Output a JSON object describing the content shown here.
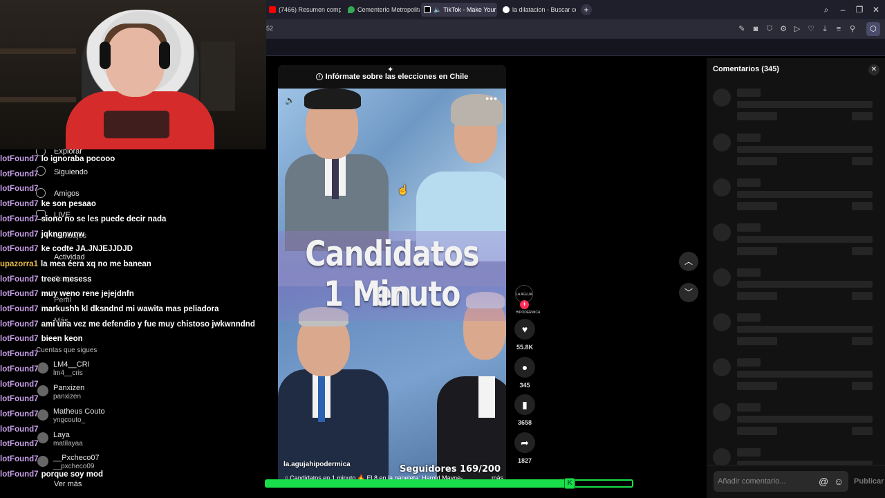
{
  "browser": {
    "tabs": [
      {
        "label": "(7466) Resumen complet",
        "color": "#ff0000",
        "active": false
      },
      {
        "label": "Cementerio Metropolitan",
        "color": "#34a853",
        "active": false
      },
      {
        "label": "TikTok - Make Your D",
        "color": "#ffffff",
        "active": true
      },
      {
        "label": "la dilatacion - Buscar con",
        "color": "#4285f4",
        "active": false
      }
    ],
    "address_fragment": "52"
  },
  "chat": {
    "messages": [
      {
        "user": "lotFound7",
        "text": "lo ignoraba pocooo"
      },
      {
        "user": "lotFound7",
        "text": ""
      },
      {
        "user": "lotFound7",
        "text": ""
      },
      {
        "user": "lotFound7",
        "text": "ke son pesaao"
      },
      {
        "user": "lotFound7",
        "text": "siono no se les puede decir nada"
      },
      {
        "user": "lotFound7",
        "text": "jqkngnwnw"
      },
      {
        "user": "lotFound7",
        "text": "ke codte JA.JNJEJJDJD"
      },
      {
        "user": "upazorra1",
        "text": "la mea éera xq no me banean",
        "gold": true
      },
      {
        "user": "lotFound7",
        "text": "treee mesess"
      },
      {
        "user": "lotFound7",
        "text": "muy weno rene jejejdnfn"
      },
      {
        "user": "lotFound7",
        "text": "markushh kl dksndnd mi wawita mas peliadora"
      },
      {
        "user": "lotFound7",
        "text": "ami una vez me defendio y fue muy chistoso jwkwnndnd"
      },
      {
        "user": "lotFound7",
        "text": "bieen keon"
      },
      {
        "user": "lotFound7",
        "text": ""
      },
      {
        "user": "lotFound7",
        "text": ""
      },
      {
        "user": "lotFound7",
        "text": ""
      },
      {
        "user": "lotFound7",
        "text": ""
      },
      {
        "user": "lotFound7",
        "text": ""
      },
      {
        "user": "lotFound7",
        "text": ""
      },
      {
        "user": "lotFound7",
        "text": ""
      },
      {
        "user": "lotFound7",
        "text": ""
      },
      {
        "user": "lotFound7",
        "text": "porque soy mod"
      }
    ]
  },
  "sidebar_ghost": {
    "explore": "Explorar",
    "following": "Siguiendo",
    "friends": "Amigos",
    "live": "LIVE",
    "messages": "Mensajes",
    "activity": "Actividad",
    "upload": "Cargar",
    "profile": "Perfil",
    "more": "Más",
    "accounts_heading": "Cuentas que sigues",
    "accounts": [
      {
        "name": "LM4__CRI",
        "handle": "lm4__cris"
      },
      {
        "name": "Panxizen",
        "handle": "panxizen"
      },
      {
        "name": "Matheus Couto",
        "handle": "yngcouto_"
      },
      {
        "name": "Laya",
        "handle": "matilayaa"
      },
      {
        "name": "__Pxcheco07",
        "handle": "__pxcheco09"
      }
    ],
    "see_more": "Ver más"
  },
  "video": {
    "info_banner": "Infórmate sobre las elecciones en Chile",
    "title_line1": "Candidatos en",
    "title_line2": "1 Minuto",
    "author": "la.agujahipodermica",
    "followers": "Seguidores 169/200",
    "description": "Candidatos en 1 minuto 🔥 El 8 en la papeleta: Harold Mayne-...",
    "description_more": "más",
    "progress": 0.83
  },
  "actions": {
    "avatar_text": "LA AGUJA HIPODÉRMICA",
    "likes": "55.8K",
    "comments": "345",
    "saves": "3658",
    "shares": "1827"
  },
  "comments_panel": {
    "title": "Comentarios (345)",
    "input_placeholder": "Añadir comentario...",
    "publish_label": "Publicar"
  },
  "colors": {
    "chat_user": "#c79fe8",
    "chat_user_alt": "#e8b94a",
    "progress_green": "#19e04a",
    "tiktok_red": "#fe2c55"
  }
}
